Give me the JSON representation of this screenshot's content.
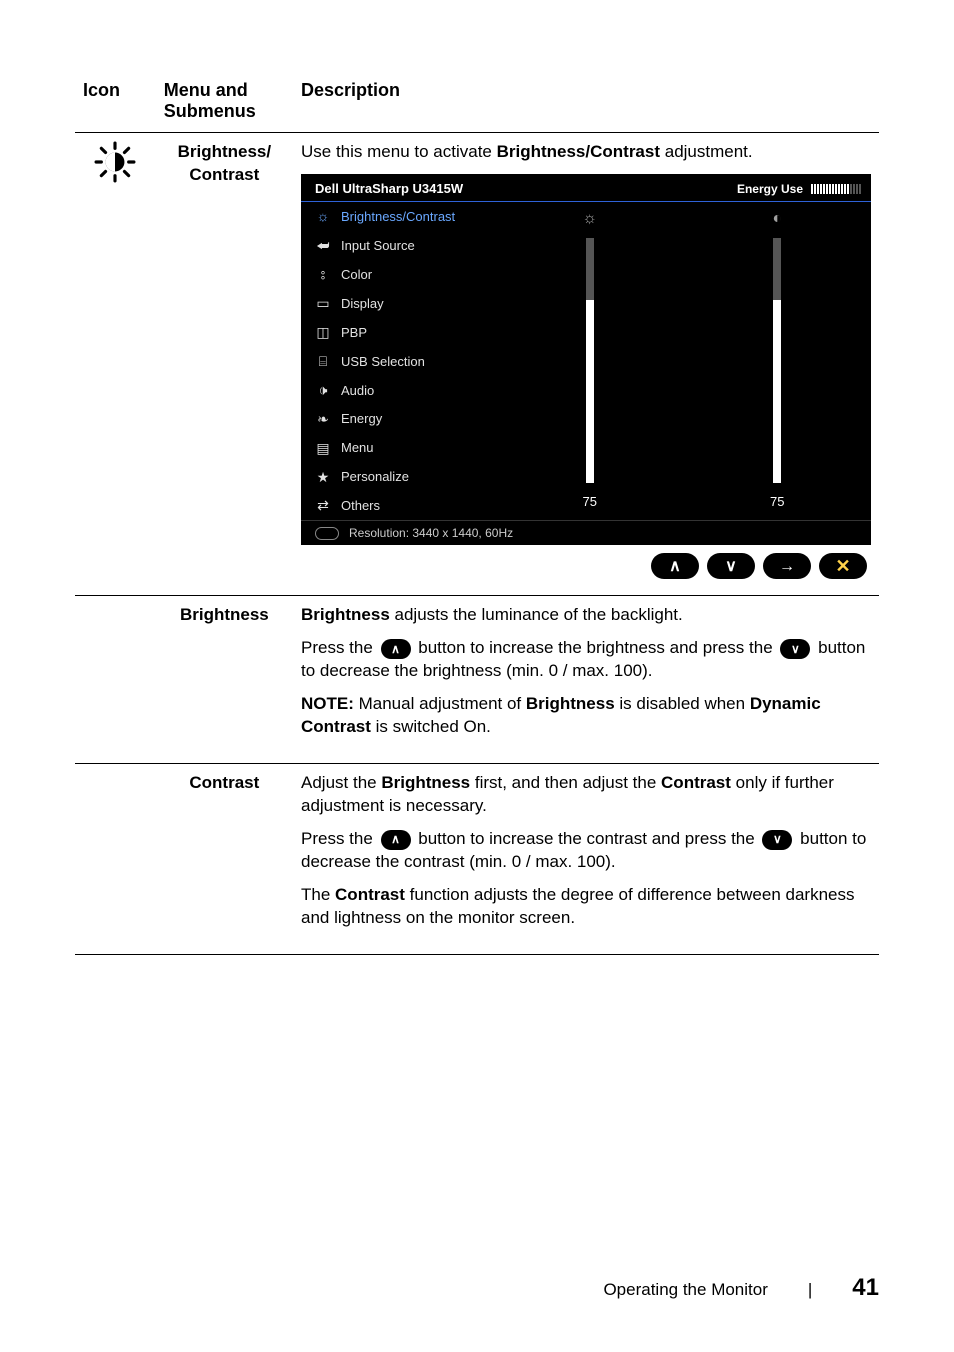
{
  "headers": {
    "icon": "Icon",
    "menu": "Menu and Submenus",
    "desc": "Description"
  },
  "rows": {
    "bc": {
      "menu": "Brightness/\nContrast",
      "intro_a": "Use this menu to activate ",
      "intro_b": "Brightness/Contrast",
      "intro_c": " adjustment."
    },
    "brightness": {
      "menu": "Brightness",
      "p1_a": "Brightness",
      "p1_b": " adjusts the luminance of the backlight.",
      "p2_a": "Press the ",
      "p2_b": " button to increase the brightness and press the ",
      "p2_c": " button to decrease the brightness (min. 0 / max. 100).",
      "p3_a": "NOTE:",
      "p3_b": " Manual adjustment of ",
      "p3_c": "Brightness",
      "p3_d": " is disabled when ",
      "p3_e": "Dynamic Contrast",
      "p3_f": " is switched On."
    },
    "contrast": {
      "menu": "Contrast",
      "p1_a": "Adjust the ",
      "p1_b": "Brightness",
      "p1_c": " first, and then adjust the ",
      "p1_d": "Contrast",
      "p1_e": " only if further adjustment is necessary.",
      "p2_a": "Press the ",
      "p2_b": " button to increase the contrast and press the ",
      "p2_c": " button to decrease the contrast (min. 0 / max. 100).",
      "p3_a": "The ",
      "p3_b": "Contrast",
      "p3_c": " function adjusts the degree of difference between darkness and lightness on the monitor screen."
    }
  },
  "osd": {
    "title": "Dell UltraSharp U3415W",
    "energy_label": "Energy Use",
    "nav": {
      "bc": "Brightness/Contrast",
      "input": "Input Source",
      "color": "Color",
      "display": "Display",
      "pbp": "PBP",
      "usb": "USB Selection",
      "audio": "Audio",
      "energy": "Energy",
      "menu": "Menu",
      "personalize": "Personalize",
      "others": "Others"
    },
    "brightness_value": "75",
    "contrast_value": "75",
    "status": "Resolution: 3440 x 1440, 60Hz",
    "btn_up": "∧",
    "btn_down": "∨",
    "btn_next": "→",
    "btn_close": "✕"
  },
  "pill_up": "∧",
  "pill_down": "∨",
  "footer": {
    "section": "Operating the Monitor",
    "sep": "|",
    "page": "41"
  }
}
